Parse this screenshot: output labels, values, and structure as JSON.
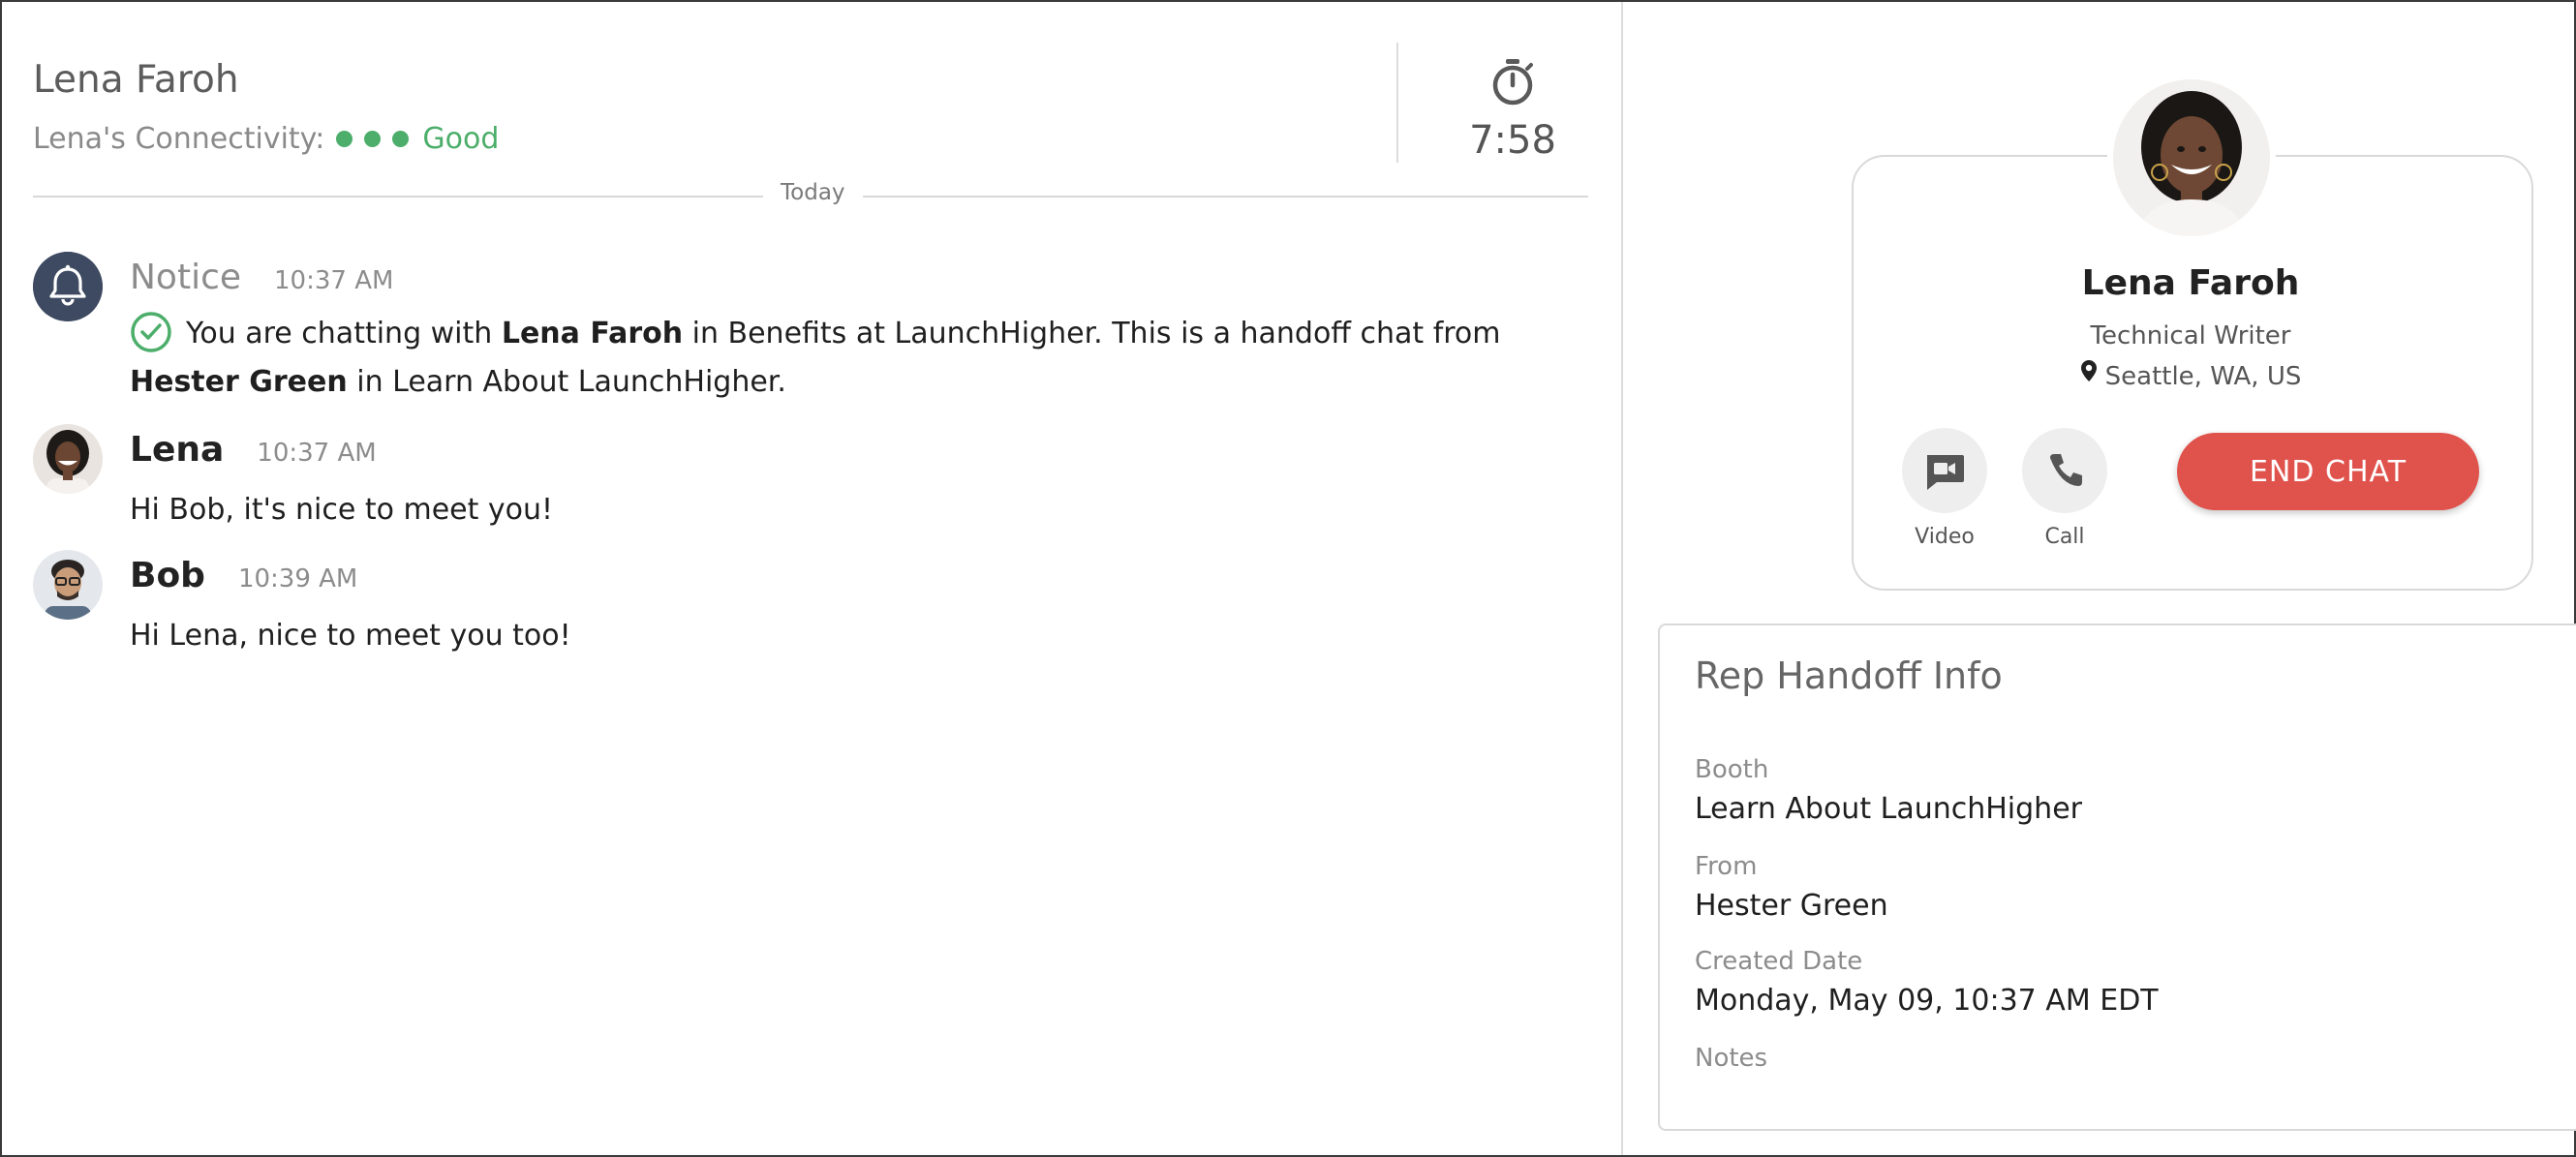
{
  "header": {
    "contact_name": "Lena Faroh",
    "connectivity_label": "Lena's Connectivity:",
    "connectivity_status": "Good",
    "timer": "7:58"
  },
  "day_separator": "Today",
  "messages": [
    {
      "sender": "Notice",
      "time": "10:37 AM",
      "text": {
        "part1": "You are chatting with ",
        "bold1": "Lena Faroh",
        "part2": " in Benefits at LaunchHigher. This is a handoff chat from ",
        "bold2": "Hester Green",
        "part3": " in Learn About LaunchHigher."
      }
    },
    {
      "sender": "Lena",
      "time": "10:37 AM",
      "text": "Hi Bob, it's nice to meet you!"
    },
    {
      "sender": "Bob",
      "time": "10:39 AM",
      "text": "Hi Lena, nice to meet you too!"
    }
  ],
  "profile": {
    "name": "Lena Faroh",
    "title": "Technical Writer",
    "location": "Seattle, WA, US",
    "video_label": "Video",
    "call_label": "Call",
    "end_chat_label": "END CHAT"
  },
  "handoff": {
    "title": "Rep Handoff Info",
    "booth_label": "Booth",
    "booth_value": "Learn About LaunchHigher",
    "from_label": "From",
    "from_value": "Hester Green",
    "created_label": "Created Date",
    "created_value": "Monday, May 09, 10:37 AM EDT",
    "notes_label": "Notes"
  },
  "colors": {
    "status_green": "#4cae6a",
    "end_chat_red": "#e0524c",
    "notice_avatar": "#3d4a61"
  },
  "icons": [
    "stopwatch-icon",
    "bell-icon",
    "check-circle-icon",
    "video-icon",
    "phone-icon",
    "location-pin-icon"
  ]
}
